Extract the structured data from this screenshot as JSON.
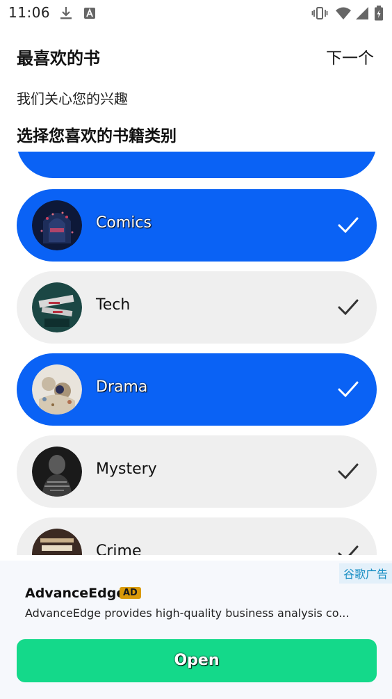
{
  "status_bar": {
    "time": "11:06",
    "icons": [
      "download-icon",
      "font-a-icon",
      "vibrate-icon",
      "wifi-icon",
      "signal-icon",
      "battery-icon"
    ]
  },
  "header": {
    "title": "最喜欢的书",
    "next_label": "下一个",
    "subtitle": "我们关心您的兴趣",
    "section_heading": "选择您喜欢的书籍类别"
  },
  "genres": [
    {
      "label": "",
      "selected": true
    },
    {
      "label": "Comics",
      "selected": true
    },
    {
      "label": "Tech",
      "selected": false
    },
    {
      "label": "Drama",
      "selected": true
    },
    {
      "label": "Mystery",
      "selected": false
    },
    {
      "label": "Crime",
      "selected": false
    }
  ],
  "ad": {
    "provider": "谷歌广告",
    "name": "AdvanceEdge",
    "badge": "AD",
    "description": "AdvanceEdge provides high-quality business analysis co...",
    "button_label": "Open"
  },
  "colors": {
    "selected": "#0a62f5",
    "unselected": "#efefef",
    "open_button": "#14d98a",
    "ad_badge": "#d99a09",
    "ad_provider_text": "#1a8fc4"
  }
}
